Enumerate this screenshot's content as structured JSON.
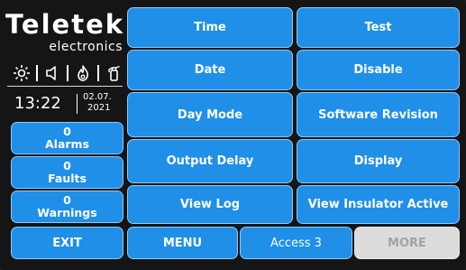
{
  "logo": {
    "brand": "Teletek",
    "subtitle": "electronics"
  },
  "status_icons": [
    "sun-icon",
    "speaker-icon",
    "flame-icon",
    "fire-extinguisher-icon"
  ],
  "clock": {
    "time": "13:22",
    "date_line1": "02.07.",
    "date_line2": "2021"
  },
  "counters": [
    {
      "count": "0",
      "label": "Alarms"
    },
    {
      "count": "0",
      "label": "Faults"
    },
    {
      "count": "0",
      "label": "Warnings"
    }
  ],
  "menu": {
    "left": [
      "Time",
      "Date",
      "Day Mode",
      "Output Delay",
      "View Log"
    ],
    "right": [
      "Test",
      "Disable",
      "Software Revision",
      "Display",
      "View Insulator Active"
    ]
  },
  "bottom_bar": {
    "exit": "EXIT",
    "menu": "MENU",
    "access": "Access 3",
    "more": "MORE"
  },
  "colors": {
    "button": "#1f8fe8",
    "button_disabled": "#dcdcdc",
    "background": "#151515"
  }
}
